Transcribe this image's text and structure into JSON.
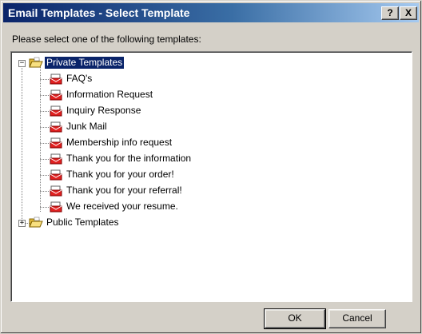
{
  "window": {
    "title": "Email Templates - Select Template",
    "help_label": "?",
    "close_label": "X"
  },
  "prompt": "Please select one of the following templates:",
  "tree": {
    "private": {
      "label": "Private Templates",
      "expander": "−",
      "items": [
        "FAQ's",
        "Information Request",
        "Inquiry Response",
        "Junk Mail",
        "Membership info request",
        "Thank you for the information",
        "Thank you for your order!",
        "Thank you for your referral!",
        "We received your resume."
      ]
    },
    "public": {
      "label": "Public Templates",
      "expander": "+"
    }
  },
  "buttons": {
    "ok": "OK",
    "cancel": "Cancel"
  },
  "colors": {
    "titlebar_start": "#0a246a",
    "titlebar_end": "#a6caf0",
    "selection": "#0a246a",
    "dialog_face": "#d4d0c8"
  }
}
